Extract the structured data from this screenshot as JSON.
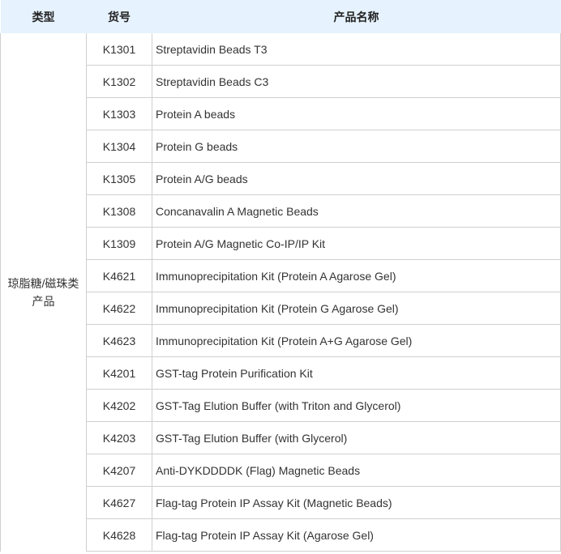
{
  "headers": {
    "type": "类型",
    "code": "货号",
    "name": "产品名称"
  },
  "category": {
    "line1": "琼脂糖/磁珠类",
    "line2": "产品"
  },
  "rows": [
    {
      "code": "K1301",
      "name": "Streptavidin Beads T3"
    },
    {
      "code": "K1302",
      "name": "Streptavidin Beads C3"
    },
    {
      "code": "K1303",
      "name": "Protein A beads"
    },
    {
      "code": "K1304",
      "name": "Protein G beads"
    },
    {
      "code": "K1305",
      "name": "Protein A/G beads"
    },
    {
      "code": "K1308",
      "name": "Concanavalin A Magnetic Beads"
    },
    {
      "code": "K1309",
      "name": "Protein A/G Magnetic Co-IP/IP Kit"
    },
    {
      "code": "K4621",
      "name": "Immunoprecipitation Kit (Protein A Agarose Gel)"
    },
    {
      "code": "K4622",
      "name": "Immunoprecipitation Kit (Protein G Agarose Gel)"
    },
    {
      "code": "K4623",
      "name": "Immunoprecipitation Kit (Protein A+G Agarose Gel)"
    },
    {
      "code": "K4201",
      "name": "GST-tag Protein Purification Kit"
    },
    {
      "code": "K4202",
      "name": "GST-Tag Elution Buffer (with Triton and Glycerol)"
    },
    {
      "code": "K4203",
      "name": "GST-Tag Elution Buffer (with Glycerol)"
    },
    {
      "code": "K4207",
      "name": "Anti-DYKDDDDK (Flag) Magnetic Beads"
    },
    {
      "code": "K4627",
      "name": "Flag-tag Protein IP Assay Kit (Magnetic Beads)"
    },
    {
      "code": "K4628",
      "name": "Flag-tag Protein IP Assay Kit (Agarose Gel)"
    }
  ]
}
